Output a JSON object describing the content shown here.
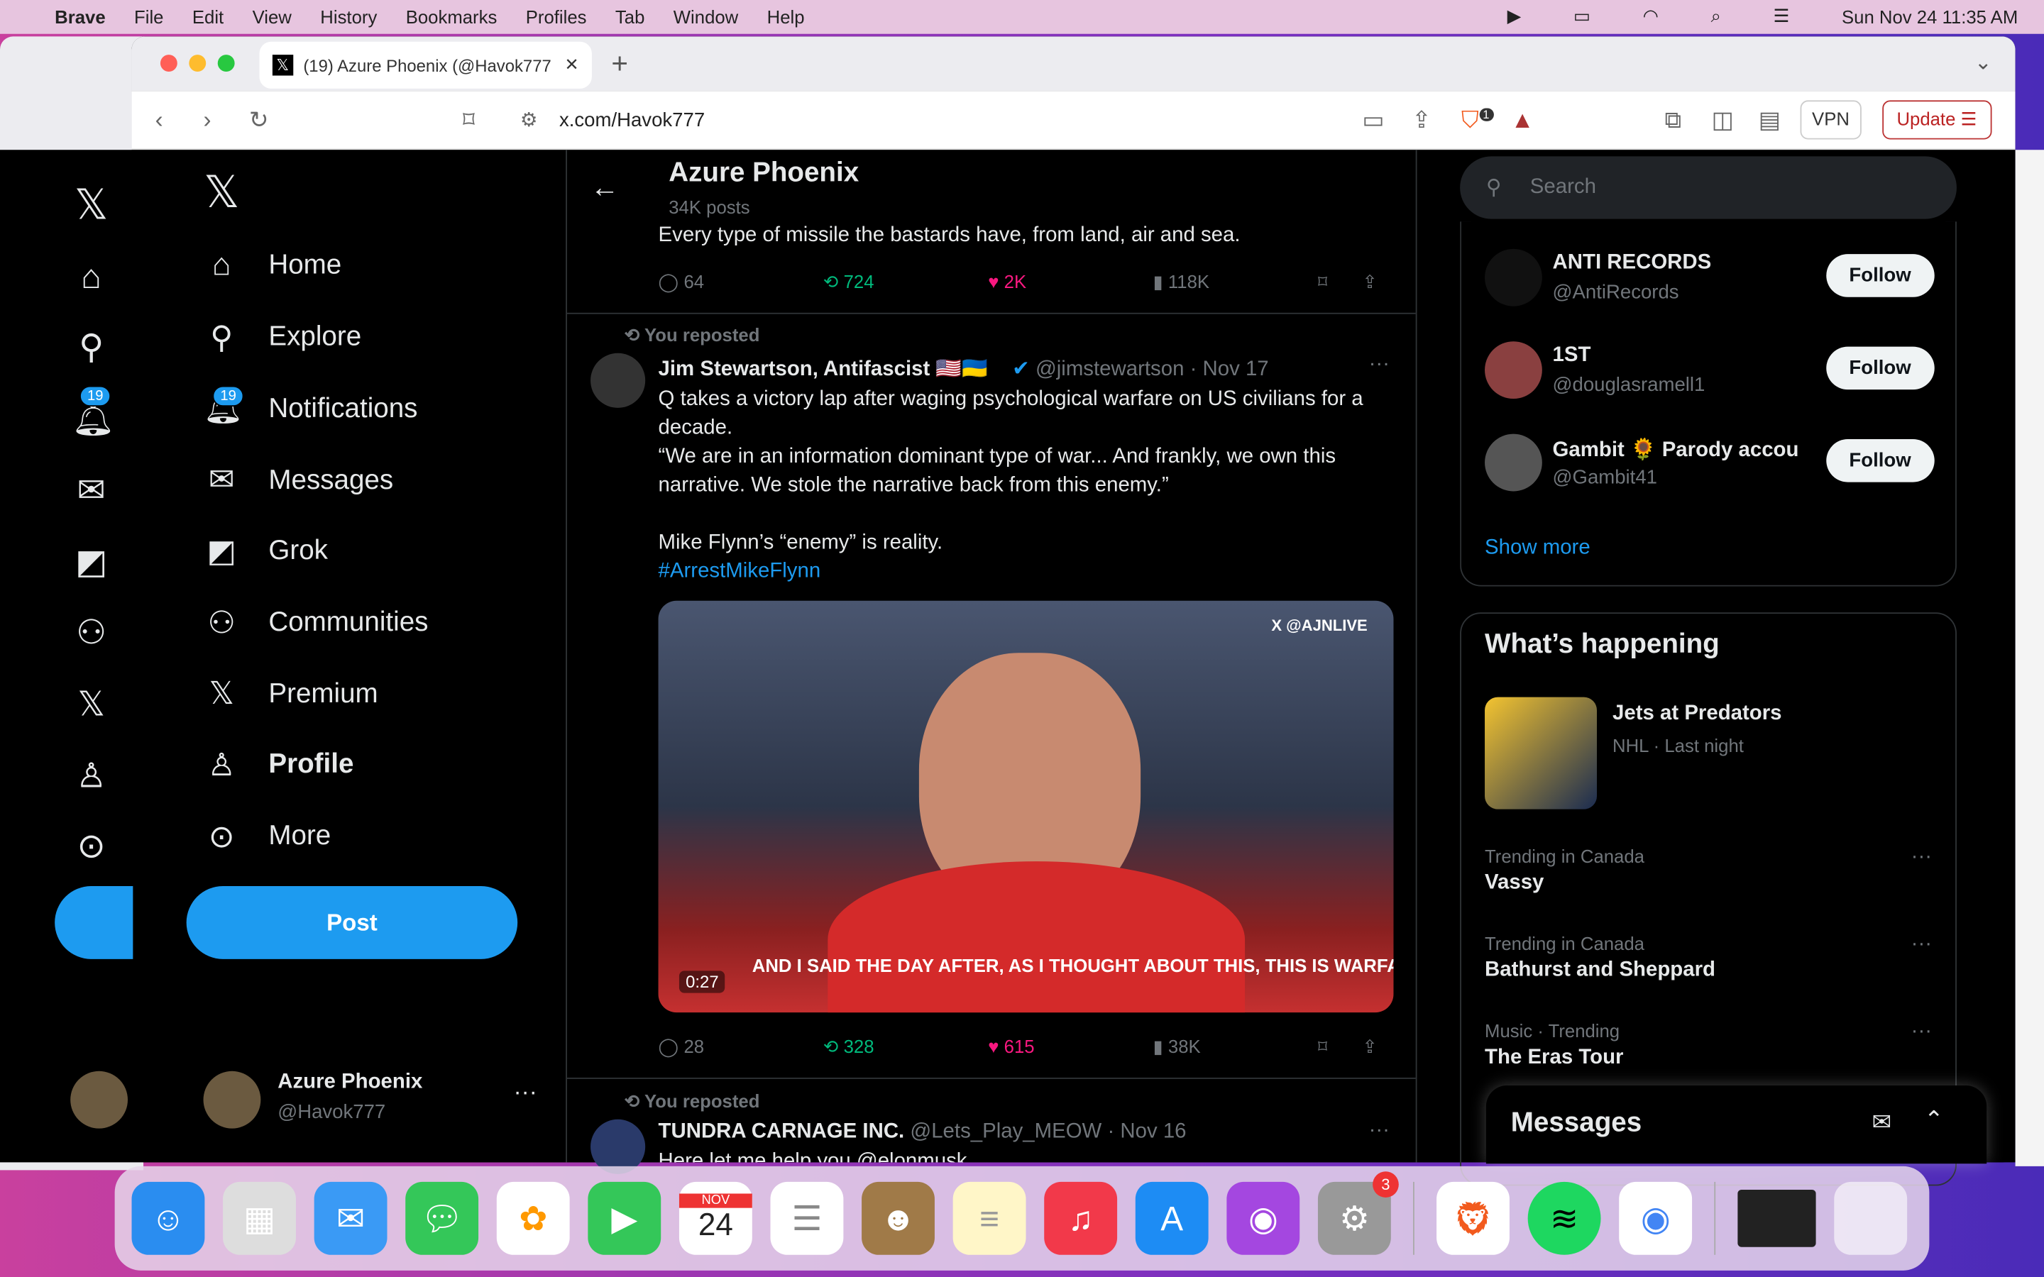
{
  "menubar": {
    "app": "Brave",
    "items": [
      "File",
      "Edit",
      "View",
      "History",
      "Bookmarks",
      "Profiles",
      "Tab",
      "Window",
      "Help"
    ],
    "clock": "Sun Nov 24  11:35 AM"
  },
  "browser": {
    "tab_title": "(19) Azure Phoenix (@Havok777",
    "url": "x.com/Havok777",
    "vpn": "VPN",
    "update": "Update",
    "shield_badge": "1"
  },
  "nav": {
    "items": [
      {
        "label": "Home",
        "icon": "home-icon"
      },
      {
        "label": "Explore",
        "icon": "search-icon"
      },
      {
        "label": "Notifications",
        "icon": "bell-icon",
        "badge": "19"
      },
      {
        "label": "Messages",
        "icon": "mail-icon"
      },
      {
        "label": "Grok",
        "icon": "grok-icon"
      },
      {
        "label": "Communities",
        "icon": "communities-icon"
      },
      {
        "label": "Premium",
        "icon": "x-icon"
      },
      {
        "label": "Profile",
        "icon": "person-icon"
      },
      {
        "label": "More",
        "icon": "more-icon"
      }
    ],
    "post": "Post",
    "account_name": "Azure Phoenix",
    "account_handle": "@Havok777"
  },
  "header": {
    "title": "Azure Phoenix",
    "subtitle": "34K posts"
  },
  "tweet0": {
    "text": "Every type of missile the bastards have, from land, air and sea.",
    "replies": "64",
    "reposts": "724",
    "likes": "2K",
    "views": "118K"
  },
  "tweet1": {
    "repost_label": "You reposted",
    "name": "Jim Stewartson, Antifascist",
    "emoji": "🇺🇸🇺🇦☠",
    "handle": "@jimstewartson · Nov 17",
    "lines": [
      "Q takes a victory lap after waging psychological warfare on US civilians for a decade.",
      "“We are in an information dominant type of war... And frankly, we own this narrative. We stole the narrative back from this enemy.”",
      "Mike Flynn’s “enemy” is reality."
    ],
    "hashtag": "#ArrestMikeFlynn",
    "video_watermark": "X @AJNLIVE",
    "video_caption": "AND I SAID THE DAY AFTER, AS I THOUGHT ABOUT THIS, THIS IS WARFARE.",
    "video_time": "0:27",
    "replies": "28",
    "reposts": "328",
    "likes": "615",
    "views": "38K"
  },
  "tweet2": {
    "repost_label": "You reposted",
    "name": "TUNDRA CARNAGE INC.",
    "handle": "@Lets_Play_MEOW · Nov 16",
    "text": "Here let me help you @elonmusk"
  },
  "search": {
    "placeholder": "Search"
  },
  "who_to_follow": [
    {
      "name": "ANTI RECORDS",
      "handle": "@AntiRecords"
    },
    {
      "name": "1ST",
      "handle": "@douglasramell1"
    },
    {
      "name": "Gambit 🌻 Parody accou",
      "handle": "@Gambit41"
    }
  ],
  "follow_label": "Follow",
  "show_more": "Show more",
  "happening": {
    "title": "What’s happening",
    "items": [
      {
        "meta": "NHL · Last night",
        "title": "Jets at Predators"
      },
      {
        "meta": "Trending in Canada",
        "title": "Vassy"
      },
      {
        "meta": "Trending in Canada",
        "title": "Bathurst and Sheppard"
      },
      {
        "meta": "Music · Trending",
        "title": "The Eras Tour"
      }
    ]
  },
  "messages_drawer": {
    "title": "Messages"
  },
  "dock": {
    "calendar_month": "NOV",
    "calendar_day": "24",
    "settings_badge": "3"
  },
  "colors": {
    "accent": "#1d9bf0",
    "repost": "#00ba7c",
    "like": "#f91880"
  }
}
